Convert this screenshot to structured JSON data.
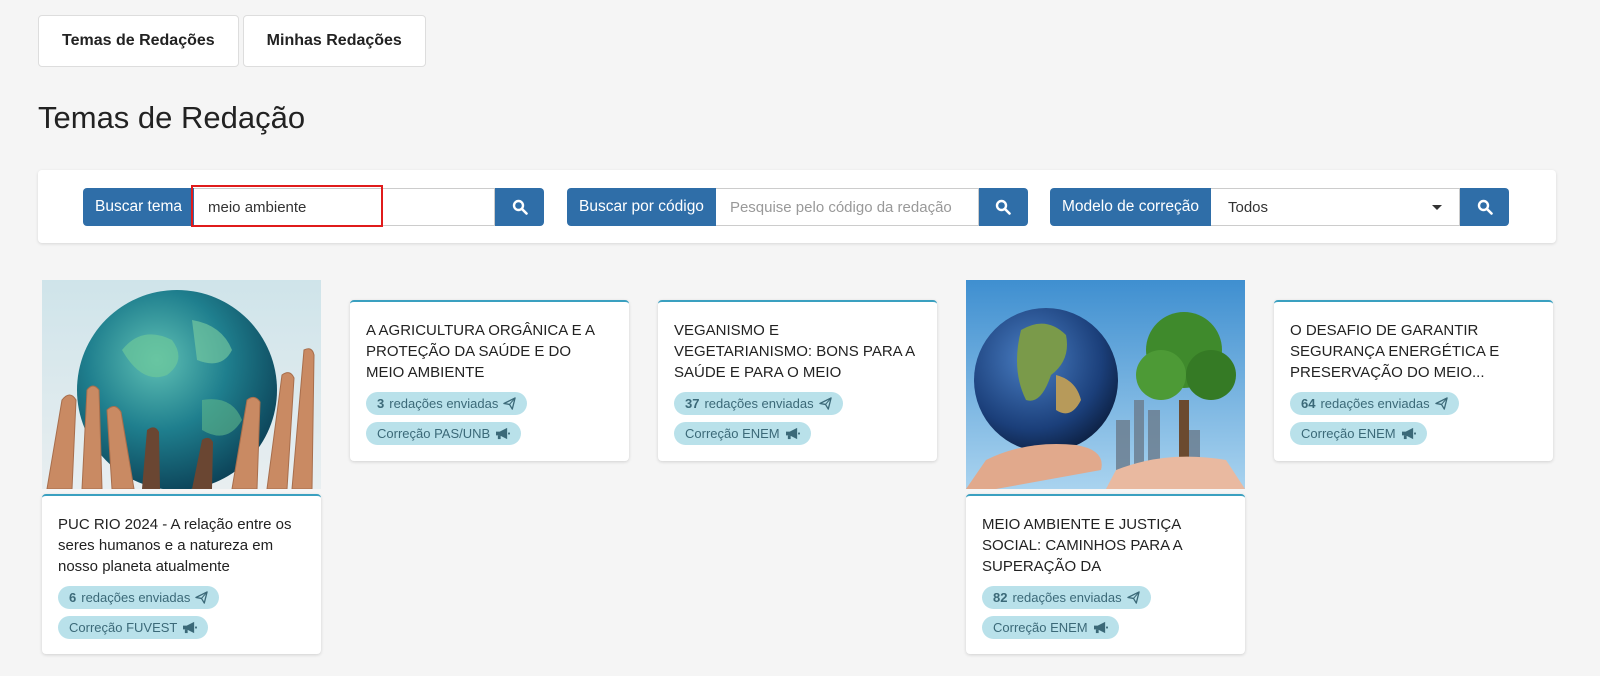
{
  "tabs": [
    {
      "label": "Temas de Redações"
    },
    {
      "label": "Minhas Redações"
    }
  ],
  "page_title": "Temas de Redação",
  "search": {
    "theme_label": "Buscar tema",
    "theme_value": "meio ambiente",
    "code_label": "Buscar por código",
    "code_placeholder": "Pesquise pelo código da redação",
    "model_label": "Modelo de correção",
    "model_value": "Todos"
  },
  "cards": [
    {
      "title": "PUC RIO 2024 - A relação entre os seres humanos e a natureza em nosso planeta atualmente",
      "count": "6",
      "count_suffix": "redações enviadas",
      "correction": "Correção FUVEST",
      "image": "hands-holding-globe"
    },
    {
      "title": "A AGRICULTURA ORGÂNICA E A PROTEÇÃO DA SAÚDE E DO MEIO AMBIENTE",
      "count": "3",
      "count_suffix": "redações enviadas",
      "correction": "Correção PAS/UNB"
    },
    {
      "title": "VEGANISMO E VEGETARIANISMO: BONS PARA A SAÚDE E PARA O MEIO AMBIENTE OU...",
      "count": "37",
      "count_suffix": "redações enviadas",
      "correction": "Correção ENEM"
    },
    {
      "title": "MEIO AMBIENTE E JUSTIÇA SOCIAL: CAMINHOS PARA A SUPERAÇÃO DA DESIGUALDADE...",
      "count": "82",
      "count_suffix": "redações enviadas",
      "correction": "Correção ENEM",
      "image": "earth-in-hand-with-tree"
    },
    {
      "title": "O DESAFIO DE GARANTIR SEGURANÇA ENERGÉTICA E PRESERVAÇÃO DO MEIO...",
      "count": "64",
      "count_suffix": "redações enviadas",
      "correction": "Correção ENEM"
    }
  ],
  "colors": {
    "primary": "#2f6ea8",
    "pill_bg": "#b9e1ea",
    "card_accent": "#3aa0c0",
    "highlight": "#e01b1b"
  }
}
